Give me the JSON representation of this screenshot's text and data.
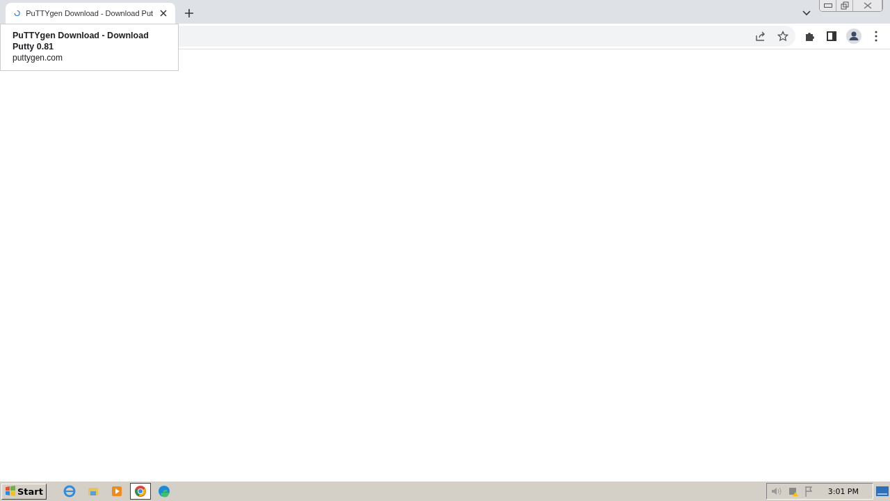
{
  "tabs": [
    {
      "title": "PuTTYgen Download - Download Put",
      "selected": true,
      "loading": true
    }
  ],
  "tooltip": {
    "title": "PuTTYgen Download - Download Putty 0.81",
    "url": "puttygen.com"
  },
  "taskbar": {
    "start": "Start",
    "apps": [
      {
        "kind": "ie",
        "selected": false
      },
      {
        "kind": "explorer",
        "selected": false
      },
      {
        "kind": "media",
        "selected": false
      },
      {
        "kind": "chrome",
        "selected": true
      },
      {
        "kind": "edge",
        "selected": false
      }
    ],
    "clock": "3:01 PM"
  }
}
